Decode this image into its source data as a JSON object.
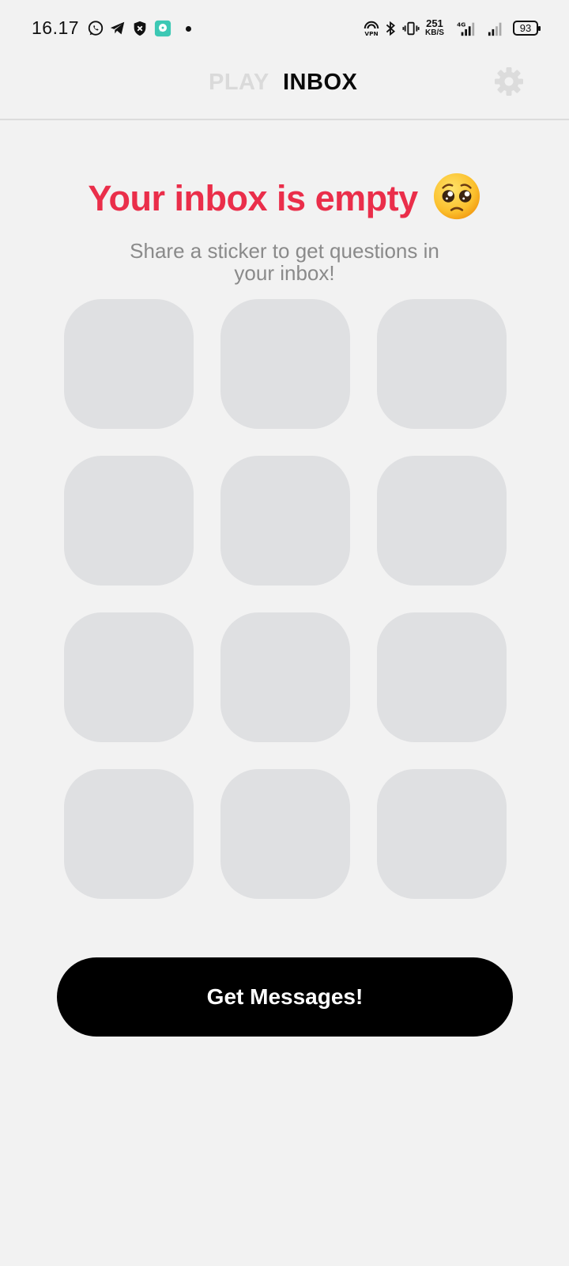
{
  "status_bar": {
    "time": "16.17",
    "net_speed_value": "251",
    "net_speed_unit": "KB/S",
    "network_type": "4G",
    "battery_level": "93"
  },
  "header": {
    "tab_play": "PLAY",
    "tab_inbox": "INBOX",
    "active_tab": "INBOX"
  },
  "empty_state": {
    "title": "Your inbox is empty",
    "subtitle": "Share a sticker to get questions in your inbox!"
  },
  "sticker_placeholders": {
    "count": 12
  },
  "cta": {
    "label": "Get Messages!"
  },
  "colors": {
    "accent_red": "#ea2e4a",
    "background": "#f2f2f2",
    "placeholder_tile": "#dfe0e2",
    "cta_background": "#000000"
  }
}
